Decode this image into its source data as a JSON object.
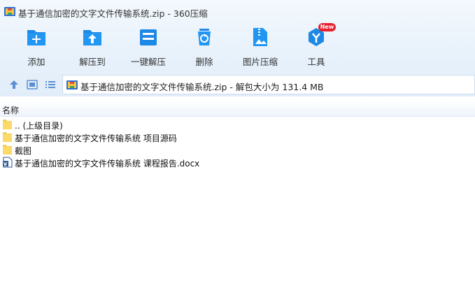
{
  "window": {
    "title": "基于通信加密的文字文件传输系统.zip - 360压缩"
  },
  "toolbar": {
    "add": "添加",
    "extract_to": "解压到",
    "one_click_extract": "一键解压",
    "delete": "删除",
    "image_compress": "图片压缩",
    "tools": "工具",
    "new_badge": "New"
  },
  "address": {
    "text": "基于通信加密的文字文件传输系统.zip - 解包大小为 131.4 MB"
  },
  "columns": {
    "name": "名称"
  },
  "files": [
    {
      "name": ".. (上级目录)",
      "kind": "folder"
    },
    {
      "name": "基于通信加密的文字文件传输系统 项目源码",
      "kind": "folder"
    },
    {
      "name": "截图",
      "kind": "folder"
    },
    {
      "name": "基于通信加密的文字文件传输系统 课程报告.docx",
      "kind": "word"
    }
  ],
  "colors": {
    "accent_blue": "#1e88e5",
    "folder_yellow": "#f7cf55",
    "badge_red": "#e8212d",
    "chrome_bg": "#e7f1fb"
  }
}
